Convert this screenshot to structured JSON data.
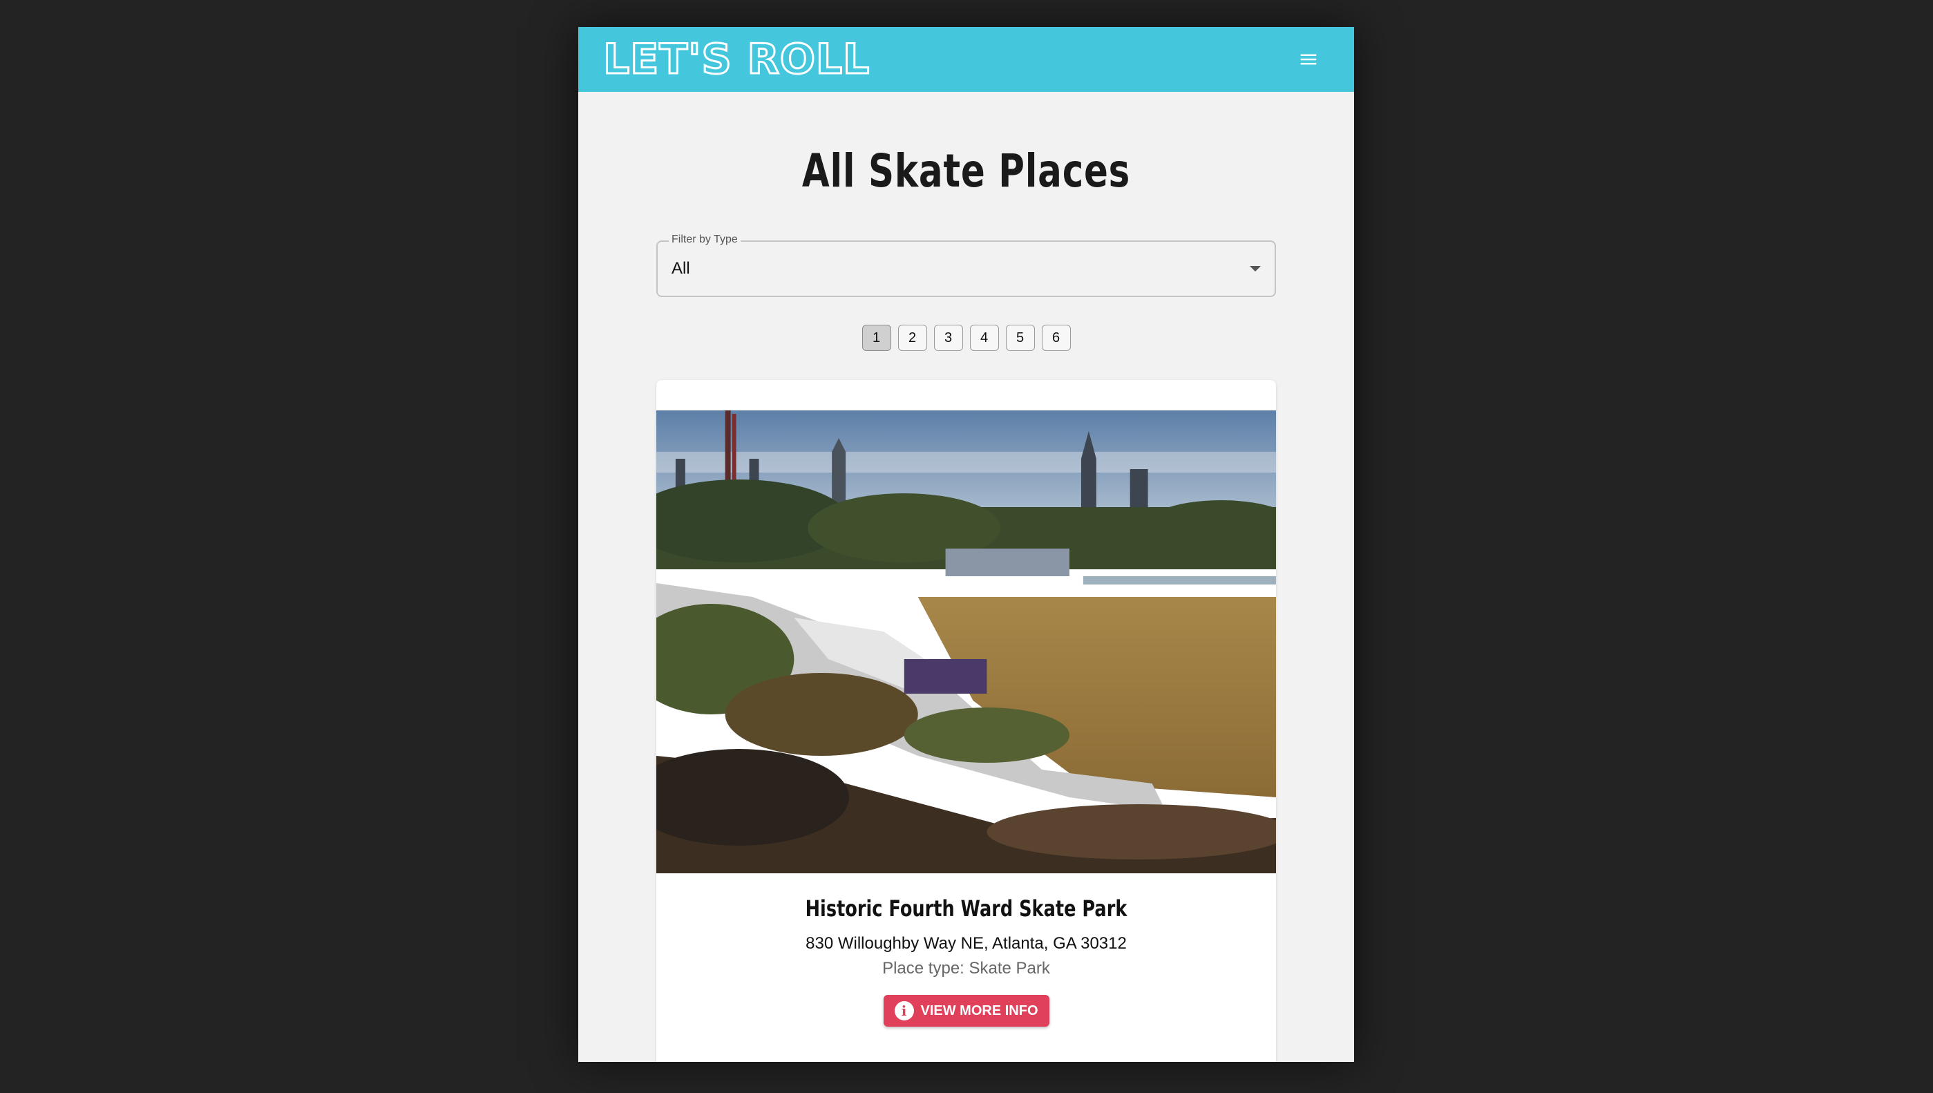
{
  "app": {
    "logo_text": "LET'S ROLL",
    "brand_color": "#44c6dc",
    "menu_icon": "hamburger-menu-icon"
  },
  "page": {
    "title": "All Skate Places"
  },
  "filter": {
    "label": "Filter by Type",
    "value": "All"
  },
  "pagination": {
    "pages": [
      "1",
      "2",
      "3",
      "4",
      "5",
      "6"
    ],
    "current": "1"
  },
  "places": [
    {
      "name": "Historic Fourth Ward Skate Park",
      "address": "830 Willoughby Way NE, Atlanta, GA 30312",
      "type_line": "Place type: Skate Park",
      "button_label": "VIEW MORE INFO",
      "button_icon": "info-icon",
      "button_color": "#e0405a"
    }
  ]
}
